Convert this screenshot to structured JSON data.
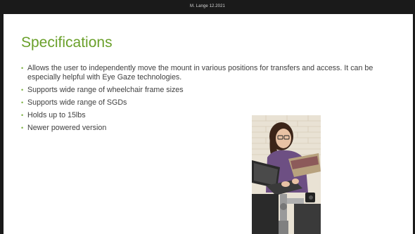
{
  "header": {
    "footer_text": "M. Lange 12.2021"
  },
  "slide": {
    "title": "Specifications",
    "bullets": [
      {
        "text": "Allows the user to independently move the mount in various positions  for transfers and access. It can be especially helpful with Eye Gaze technologies."
      },
      {
        "text": "Supports wide range of wheelchair frame sizes"
      },
      {
        "text": "Supports wide range of SGDs"
      },
      {
        "text": "Holds up to 15lbs"
      },
      {
        "text": "Newer powered version"
      }
    ],
    "bullet_glyph": "•"
  },
  "colors": {
    "title": "#6aa02a",
    "bullet": "#7ab040",
    "text": "#404040",
    "bar": "#1a1a1a"
  }
}
